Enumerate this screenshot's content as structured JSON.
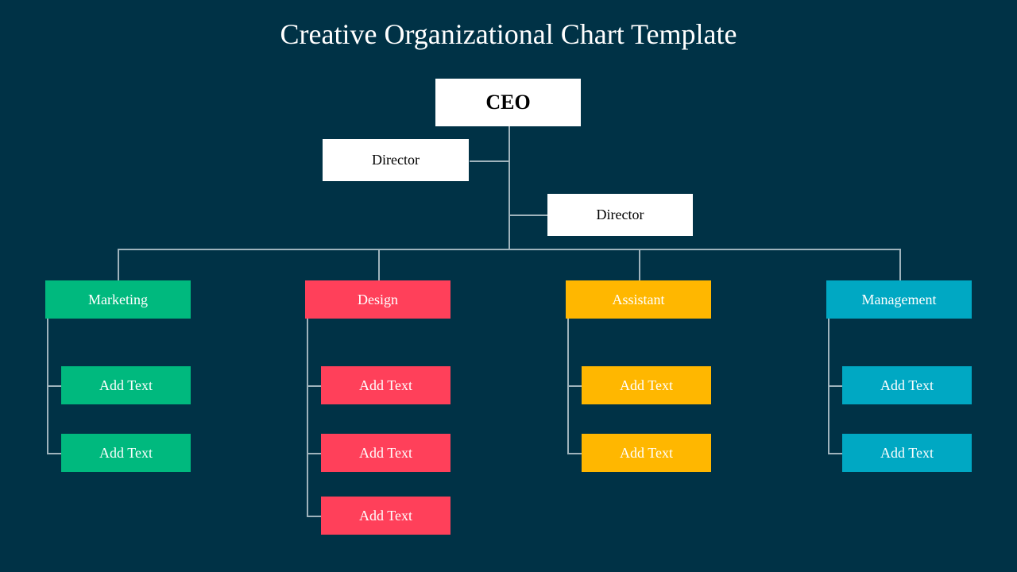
{
  "title": "Creative Organizational Chart Template",
  "ceo": {
    "label": "CEO"
  },
  "directors": [
    {
      "label": "Director"
    },
    {
      "label": "Director"
    }
  ],
  "departments": [
    {
      "label": "Marketing",
      "color": "#00B97E",
      "children": [
        "Add Text",
        "Add Text"
      ]
    },
    {
      "label": "Design",
      "color": "#FF405A",
      "children": [
        "Add Text",
        "Add Text",
        "Add Text"
      ]
    },
    {
      "label": "Assistant",
      "color": "#FFB700",
      "children": [
        "Add Text",
        "Add Text"
      ]
    },
    {
      "label": "Management",
      "color": "#00A8C3",
      "children": [
        "Add Text",
        "Add Text"
      ]
    }
  ]
}
